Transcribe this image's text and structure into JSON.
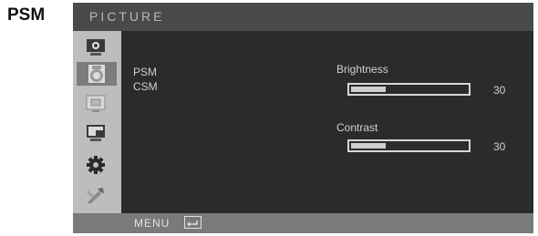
{
  "page_label": "PSM",
  "osd": {
    "title": "PICTURE",
    "sidebar_icons": [
      {
        "name": "monitor-icon",
        "active": false
      },
      {
        "name": "picture-icon",
        "active": true
      },
      {
        "name": "screen-position-icon",
        "active": false
      },
      {
        "name": "display-setup-icon",
        "active": false
      },
      {
        "name": "settings-gear-icon",
        "active": false
      },
      {
        "name": "tools-icon",
        "active": false
      }
    ],
    "items": [
      "PSM",
      "CSM"
    ],
    "controls": {
      "brightness": {
        "label": "Brightness",
        "value": "30",
        "level": 0.3
      },
      "contrast": {
        "label": "Contrast",
        "value": "30",
        "level": 0.3
      }
    },
    "footer": {
      "menu_label": "MENU",
      "enter_icon": "enter-icon"
    }
  },
  "colors": {
    "panel": "#2b2b2b",
    "titlebar": "#4a4a4a",
    "sidebar": "#bdbdbd",
    "footer": "#7a7a7a",
    "text": "#d0d0d0"
  }
}
